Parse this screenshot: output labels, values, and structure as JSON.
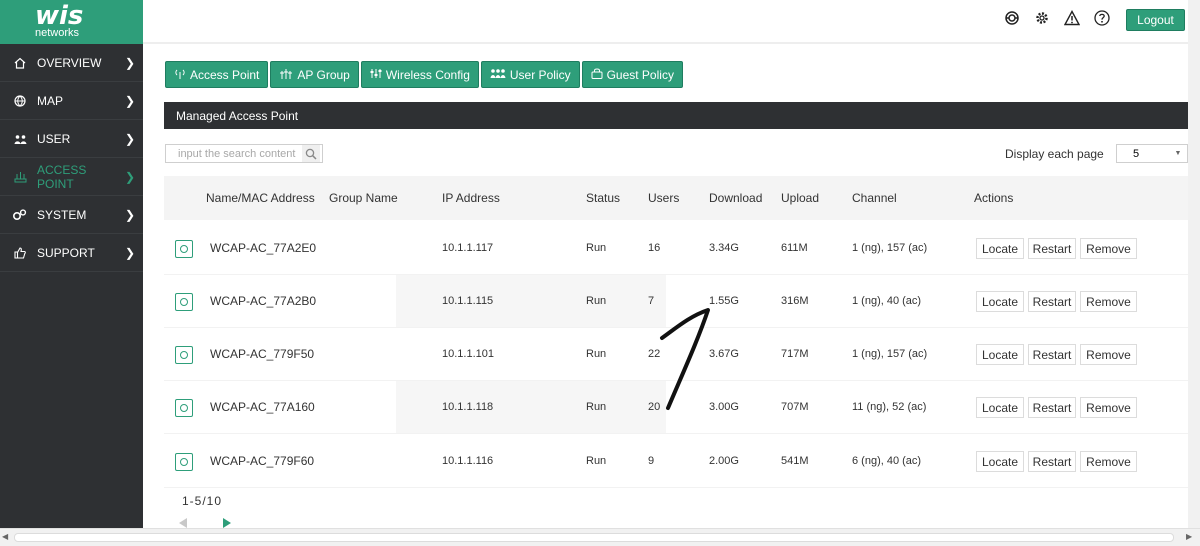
{
  "brand": {
    "logo": "wis",
    "sub": "networks",
    "accent": "#2e9e7a",
    "sidebar_bg": "#2e3033"
  },
  "sidebar": {
    "items": [
      {
        "label": "OVERVIEW",
        "icon": "home-icon"
      },
      {
        "label": "MAP",
        "icon": "globe-icon"
      },
      {
        "label": "USER",
        "icon": "users-icon"
      },
      {
        "label": "ACCESS POINT",
        "icon": "access-point-icon",
        "active": true
      },
      {
        "label": "SYSTEM",
        "icon": "system-icon"
      },
      {
        "label": "SUPPORT",
        "icon": "support-icon"
      }
    ]
  },
  "topbar": {
    "icons": [
      "refresh-icon",
      "gear-icon",
      "warning-icon",
      "help-icon"
    ],
    "logout_label": "Logout"
  },
  "tabs": [
    {
      "label": "Access Point",
      "icon": "antenna-icon"
    },
    {
      "label": "AP Group",
      "icon": "group-icon"
    },
    {
      "label": "Wireless Config",
      "icon": "wireless-icon"
    },
    {
      "label": "User Policy",
      "icon": "user-policy-icon"
    },
    {
      "label": "Guest Policy",
      "icon": "guest-icon"
    }
  ],
  "panel": {
    "title": "Managed Access Point"
  },
  "search": {
    "placeholder": "input the search content"
  },
  "page_size": {
    "label": "Display each page",
    "value": "5"
  },
  "table": {
    "columns": [
      "Name/MAC Address",
      "Group Name",
      "IP Address",
      "Status",
      "Users",
      "Download",
      "Upload",
      "Channel",
      "Actions"
    ],
    "rows": [
      {
        "name": "WCAP-AC_77A2E0",
        "group": "",
        "ip": "10.1.1.117",
        "status": "Run",
        "users": "16",
        "download": "3.34G",
        "upload": "611M",
        "channel": "1 (ng), 157 (ac)"
      },
      {
        "name": "WCAP-AC_77A2B0",
        "group": "",
        "ip": "10.1.1.115",
        "status": "Run",
        "users": "7",
        "download": "1.55G",
        "upload": "316M",
        "channel": "1 (ng), 40 (ac)"
      },
      {
        "name": "WCAP-AC_779F50",
        "group": "",
        "ip": "10.1.1.101",
        "status": "Run",
        "users": "22",
        "download": "3.67G",
        "upload": "717M",
        "channel": "1 (ng), 157 (ac)"
      },
      {
        "name": "WCAP-AC_77A160",
        "group": "",
        "ip": "10.1.1.118",
        "status": "Run",
        "users": "20",
        "download": "3.00G",
        "upload": "707M",
        "channel": "11 (ng), 52 (ac)"
      },
      {
        "name": "WCAP-AC_779F60",
        "group": "",
        "ip": "10.1.1.116",
        "status": "Run",
        "users": "9",
        "download": "2.00G",
        "upload": "541M",
        "channel": "6 (ng), 40 (ac)"
      }
    ],
    "actions": {
      "locate": "Locate",
      "restart": "Restart",
      "remove": "Remove"
    }
  },
  "pagination": {
    "info": "1-5/10"
  }
}
